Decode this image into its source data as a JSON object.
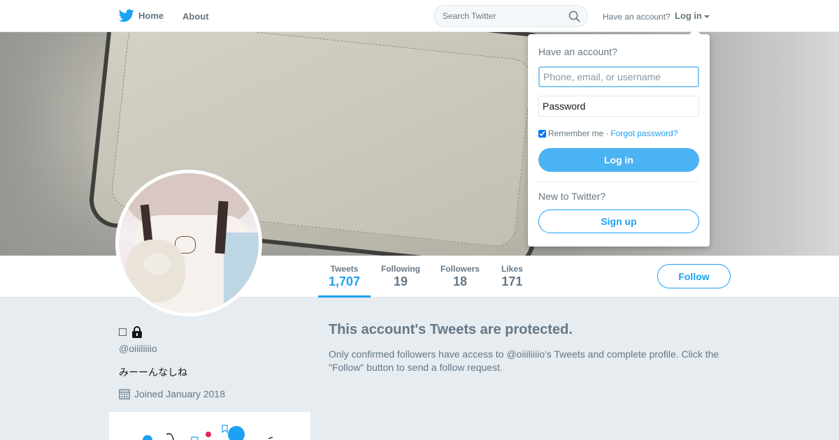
{
  "nav": {
    "home_label": "Home",
    "about_label": "About",
    "search_placeholder": "Search Twitter",
    "have_account_label": "Have an account?",
    "login_label": "Log in",
    "icons": {
      "logo": "twitter-bird-icon",
      "search": "search-icon",
      "caret": "caret-down-icon"
    }
  },
  "profile": {
    "display_name_glyph": "□",
    "protected_icon": "lock-icon",
    "handle": "@oiiiliiiio",
    "bio": "みーーんなしね",
    "joined": "Joined January 2018"
  },
  "stats": [
    {
      "label": "Tweets",
      "value": "1,707",
      "active": true
    },
    {
      "label": "Following",
      "value": "19",
      "active": false
    },
    {
      "label": "Followers",
      "value": "18",
      "active": false
    },
    {
      "label": "Likes",
      "value": "171",
      "active": false
    }
  ],
  "follow_label": "Follow",
  "protected": {
    "title": "This account's Tweets are protected.",
    "text": "Only confirmed followers have access to @oiiiliiiio's Tweets and complete profile. Click the \"Follow\" button to send a follow request."
  },
  "login_dropdown": {
    "title": "Have an account?",
    "username_placeholder": "Phone, email, or username",
    "password_placeholder": "Password",
    "remember_label": "Remember me",
    "separator": "·",
    "forgot_label": "Forgot password?",
    "login_button": "Log in",
    "new_label": "New to Twitter?",
    "signup_button": "Sign up"
  },
  "colors": {
    "accent": "#1da1f2",
    "button_fill": "#4ab3f4",
    "page_bg": "#e6ecf0",
    "muted_text": "#657786"
  }
}
